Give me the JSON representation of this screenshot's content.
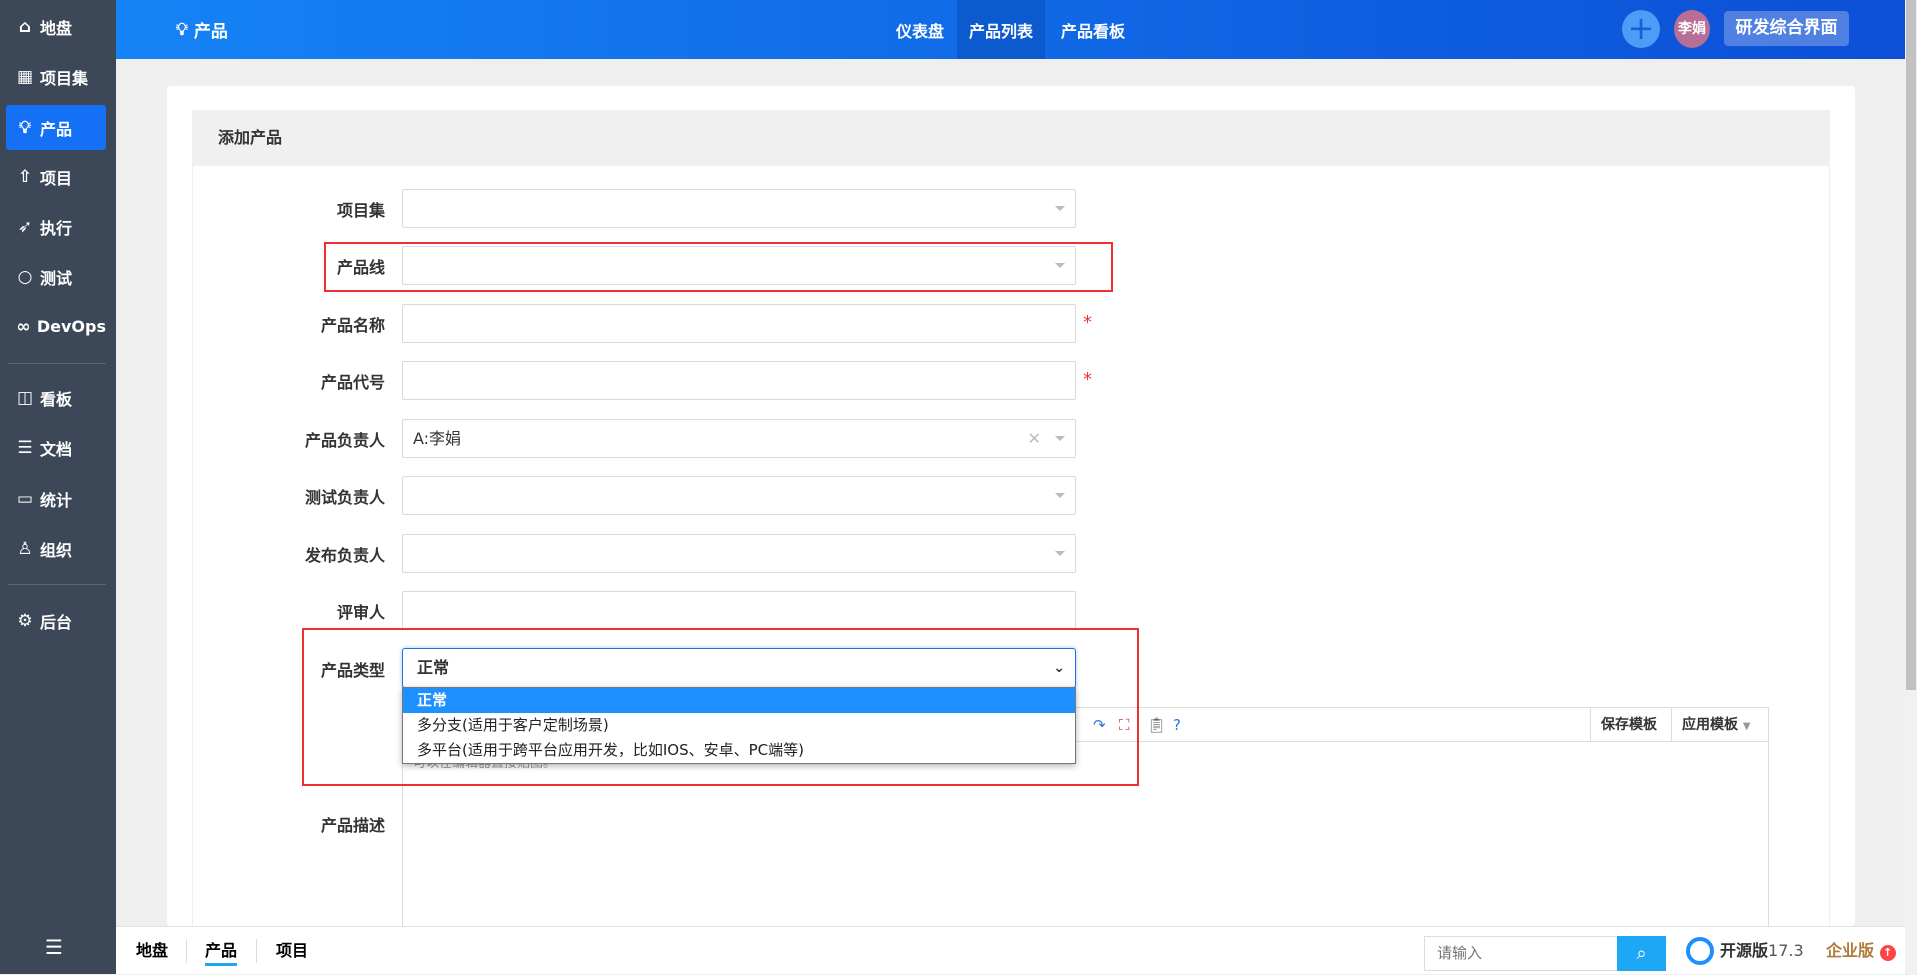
{
  "sidebar": {
    "items": [
      {
        "label": "地盘",
        "icon": "home-icon"
      },
      {
        "label": "项目集",
        "icon": "grid-icon"
      },
      {
        "label": "产品",
        "icon": "bulb-icon",
        "active": true
      },
      {
        "label": "项目",
        "icon": "rocket-icon"
      },
      {
        "label": "执行",
        "icon": "run-icon"
      },
      {
        "label": "测试",
        "icon": "search-icon"
      },
      {
        "label": "DevOps",
        "icon": "infinity-icon"
      },
      {
        "label": "看板",
        "icon": "kanban-icon"
      },
      {
        "label": "文档",
        "icon": "doc-icon"
      },
      {
        "label": "统计",
        "icon": "chart-icon"
      },
      {
        "label": "组织",
        "icon": "users-icon"
      },
      {
        "label": "后台",
        "icon": "gear-icon"
      }
    ]
  },
  "header": {
    "title": "产品",
    "nav": [
      "仪表盘",
      "产品列表",
      "产品看板"
    ],
    "active_nav": "产品列表",
    "avatar": "李娟",
    "env_button": "研发综合界面",
    "accent": "#1470f5"
  },
  "form": {
    "title": "添加产品",
    "fields": {
      "program": {
        "label": "项目集",
        "value": ""
      },
      "line": {
        "label": "产品线",
        "value": ""
      },
      "name": {
        "label": "产品名称",
        "value": "",
        "required": true
      },
      "code": {
        "label": "产品代号",
        "value": "",
        "required": true
      },
      "po": {
        "label": "产品负责人",
        "value": "A:李娟"
      },
      "qd": {
        "label": "测试负责人",
        "value": ""
      },
      "rd": {
        "label": "发布负责人",
        "value": ""
      },
      "reviewer": {
        "label": "评审人",
        "value": ""
      },
      "type": {
        "label": "产品类型",
        "value": "正常",
        "options": [
          "正常",
          "多分支(适用于客户定制场景)",
          "多平台(适用于跨平台应用开发，比如IOS、安卓、PC端等)"
        ]
      },
      "desc": {
        "label": "产品描述",
        "placeholder": "可以在编辑器直接贴图。"
      }
    },
    "editor": {
      "save_template": "保存模板",
      "apply_template": "应用模板"
    }
  },
  "footer": {
    "breadcrumbs": [
      "地盘",
      "产品",
      "项目"
    ],
    "search_placeholder": "请输入",
    "edition": "开源版",
    "version": "17.3",
    "enterprise": "企业版"
  }
}
